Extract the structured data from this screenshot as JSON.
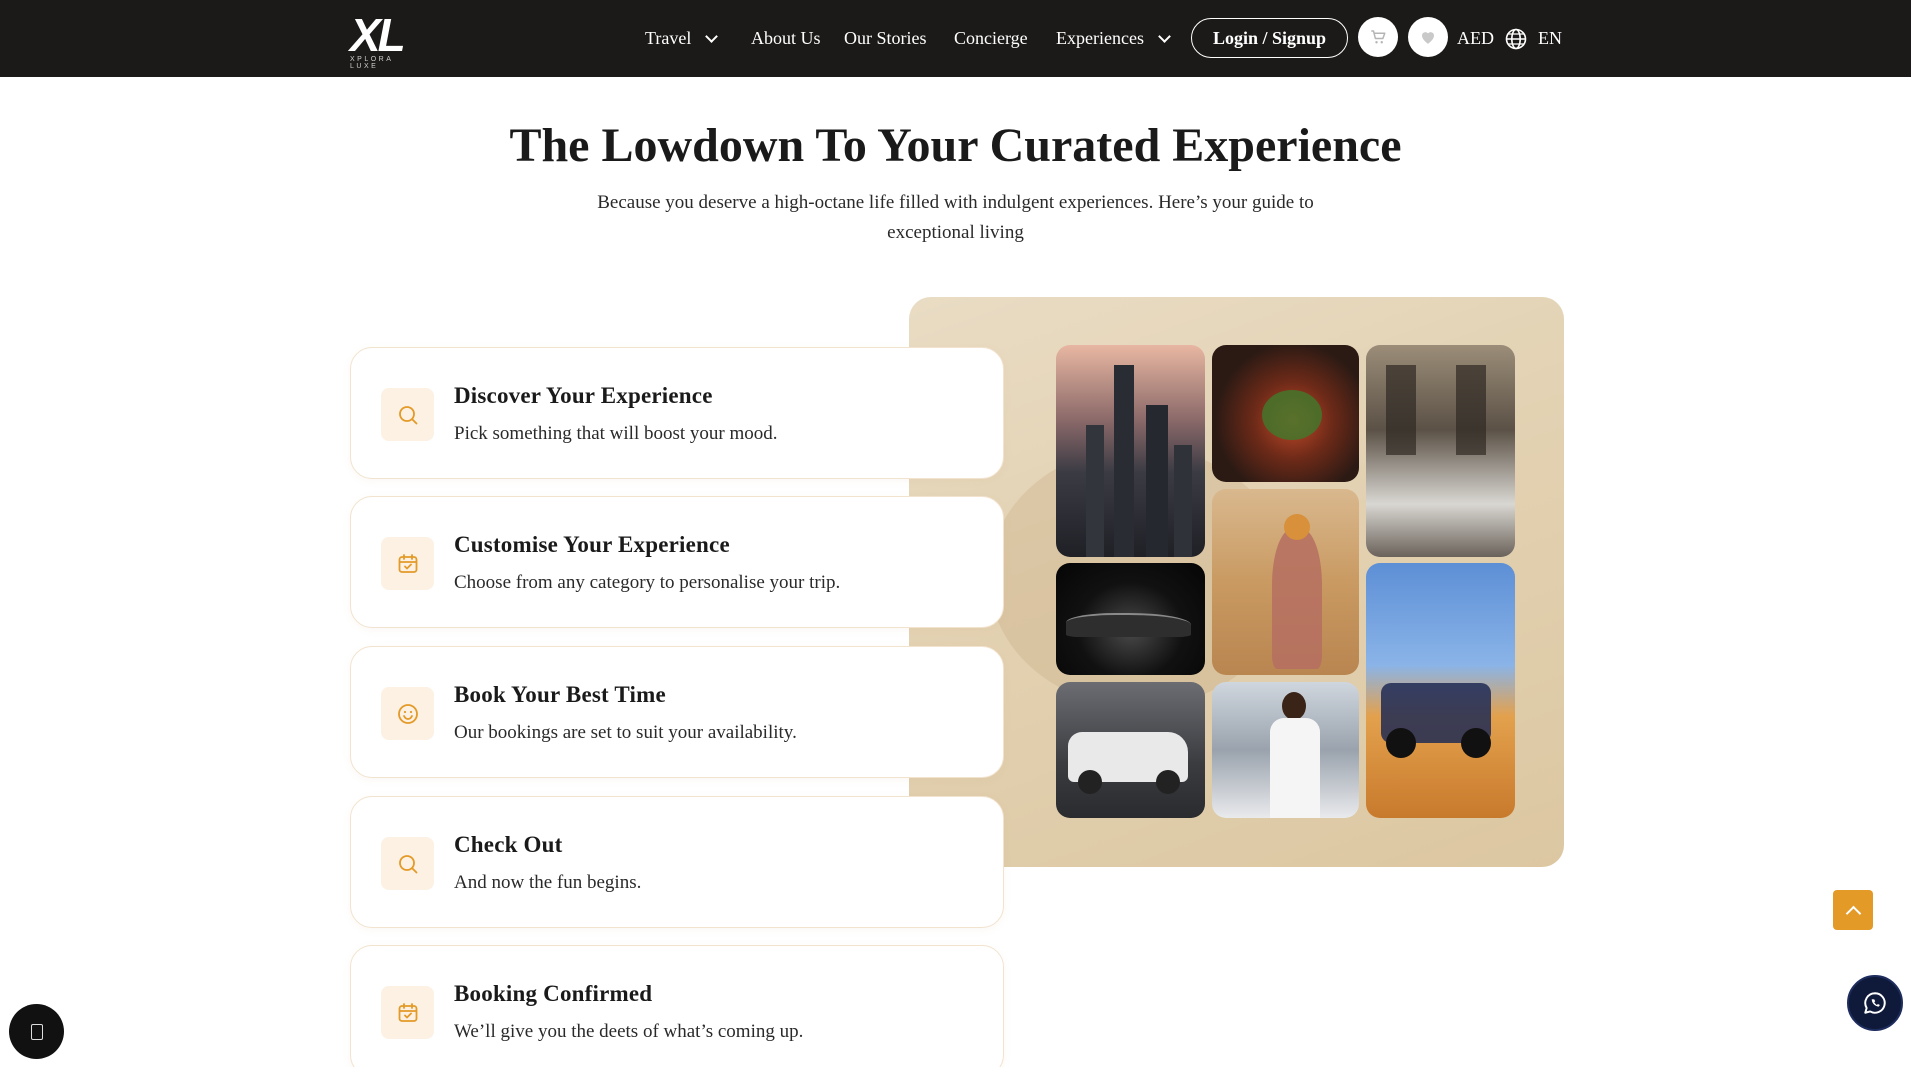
{
  "brand": {
    "logo_text": "XL",
    "logo_tagline": "XPLORA LUXE"
  },
  "nav": {
    "items": [
      {
        "label": "Travel",
        "has_dropdown": true
      },
      {
        "label": "About Us",
        "has_dropdown": false
      },
      {
        "label": "Our Stories",
        "has_dropdown": false
      },
      {
        "label": "Concierge",
        "has_dropdown": false
      },
      {
        "label": "Experiences",
        "has_dropdown": true
      }
    ],
    "login_label": "Login / Signup",
    "cart_icon": "cart-icon",
    "wishlist_icon": "heart-icon",
    "currency": "AED",
    "language": "EN",
    "language_icon": "globe-icon"
  },
  "hero": {
    "title": "The Lowdown To Your Curated Experience",
    "subtitle": "Because you deserve a high-octane life filled with indulgent experiences. Here’s your guide to exceptional living"
  },
  "steps": [
    {
      "icon": "search-icon",
      "title": "Discover Your Experience",
      "description": "Pick something that will boost your mood."
    },
    {
      "icon": "calendar-check-icon",
      "title": "Customise Your Experience",
      "description": "Choose from any category to personalise your trip."
    },
    {
      "icon": "smiley-icon",
      "title": "Book Your Best Time",
      "description": "Our bookings are set to suit your availability."
    },
    {
      "icon": "search-icon",
      "title": "Check Out",
      "description": "And now the fun begins."
    },
    {
      "icon": "calendar-check-icon",
      "title": "Booking Confirmed",
      "description": "We’ll give you the deets of what’s coming up."
    }
  ],
  "gallery": {
    "tiles": [
      "city-skyline-photo",
      "food-platter-photo",
      "restaurant-interior-photo",
      "black-sedan-photo",
      "desert-woman-photo",
      "dune-buggy-photo",
      "white-suv-photo",
      "chauffeur-photo"
    ]
  },
  "colors": {
    "accent": "#e39a27",
    "nav_bg": "#1b1a18",
    "icon_bg": "#fcf1e3",
    "card_border": "#f2e3cf",
    "panel_bg": "#e3d2b3"
  },
  "floating": {
    "scroll_top_icon": "chevron-up-icon",
    "whatsapp_icon": "whatsapp-icon",
    "chat_icon": "chat-icon"
  }
}
